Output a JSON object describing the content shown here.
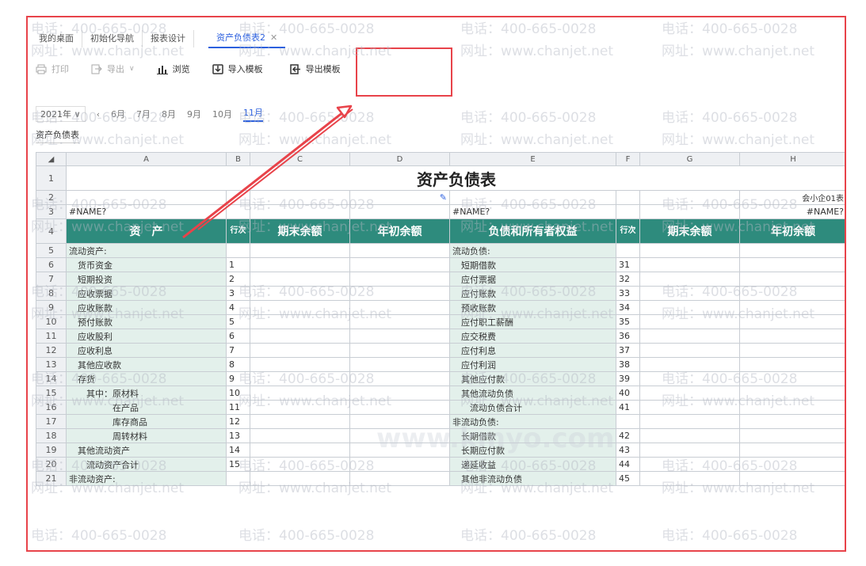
{
  "tabs": [
    {
      "label": "我的桌面"
    },
    {
      "label": "初始化导航"
    },
    {
      "label": "报表设计"
    },
    {
      "label": "资产负债表2",
      "active": true
    }
  ],
  "toolbar": {
    "print": "打印",
    "export": "导出",
    "browse": "浏览",
    "import_template": "导入模板",
    "export_template": "导出模板"
  },
  "periods": {
    "year": "2021年",
    "months": [
      "6月",
      "7月",
      "8月",
      "9月",
      "10月",
      "11月"
    ],
    "active": "11月"
  },
  "sheet_name": "资产负债表",
  "columns": [
    "A",
    "B",
    "C",
    "D",
    "E",
    "F",
    "G",
    "H"
  ],
  "title": "资产负债表",
  "form_code": "会小企01表",
  "name_left": "#NAME?",
  "name_mid": "#NAME?",
  "name_right": "#NAME?",
  "headers": {
    "assets": "资　产",
    "line": "行次",
    "end_balance": "期末余额",
    "begin_balance": "年初余额",
    "liabilities": "负债和所有者权益",
    "line2": "行次",
    "end_balance2": "期末余额",
    "begin_balance2": "年初余额"
  },
  "rows": [
    {
      "n": "5",
      "a": "流动资产:",
      "b": "",
      "e": "流动负债:",
      "f": ""
    },
    {
      "n": "6",
      "a": "　货币资金",
      "b": "1",
      "e": "　短期借款",
      "f": "31"
    },
    {
      "n": "7",
      "a": "　短期投资",
      "b": "2",
      "e": "　应付票据",
      "f": "32"
    },
    {
      "n": "8",
      "a": "　应收票据",
      "b": "3",
      "e": "　应付账款",
      "f": "33"
    },
    {
      "n": "9",
      "a": "　应收账款",
      "b": "4",
      "e": "　预收账款",
      "f": "34"
    },
    {
      "n": "10",
      "a": "　预付账款",
      "b": "5",
      "e": "　应付职工薪酬",
      "f": "35"
    },
    {
      "n": "11",
      "a": "　应收股利",
      "b": "6",
      "e": "　应交税费",
      "f": "36"
    },
    {
      "n": "12",
      "a": "　应收利息",
      "b": "7",
      "e": "　应付利息",
      "f": "37"
    },
    {
      "n": "13",
      "a": "　其他应收款",
      "b": "8",
      "e": "　应付利润",
      "f": "38"
    },
    {
      "n": "14",
      "a": "　存货",
      "b": "9",
      "e": "　其他应付款",
      "f": "39"
    },
    {
      "n": "15",
      "a": "　　其中：原材料",
      "b": "10",
      "e": "　其他流动负债",
      "f": "40"
    },
    {
      "n": "16",
      "a": "　　　　　在产品",
      "b": "11",
      "e": "　　流动负债合计",
      "f": "41"
    },
    {
      "n": "17",
      "a": "　　　　　库存商品",
      "b": "12",
      "e": "非流动负债:",
      "f": ""
    },
    {
      "n": "18",
      "a": "　　　　　周转材料",
      "b": "13",
      "e": "　长期借款",
      "f": "42"
    },
    {
      "n": "19",
      "a": "　其他流动资产",
      "b": "14",
      "e": "　长期应付款",
      "f": "43"
    },
    {
      "n": "20",
      "a": "　　流动资产合计",
      "b": "15",
      "e": "　递延收益",
      "f": "44"
    },
    {
      "n": "21",
      "a": "非流动资产:",
      "b": "",
      "e": "　其他非流动负债",
      "f": "45"
    }
  ],
  "watermark": {
    "phone": "电话：400-665-0028",
    "site": "网址：www.chanjet.net",
    "brand": "www.kmyo.com"
  },
  "colors": {
    "header_teal": "#2e8b7d",
    "label_fill": "#e3f0eb",
    "highlight_red": "#e8434a",
    "active_blue": "#2b5fde"
  }
}
